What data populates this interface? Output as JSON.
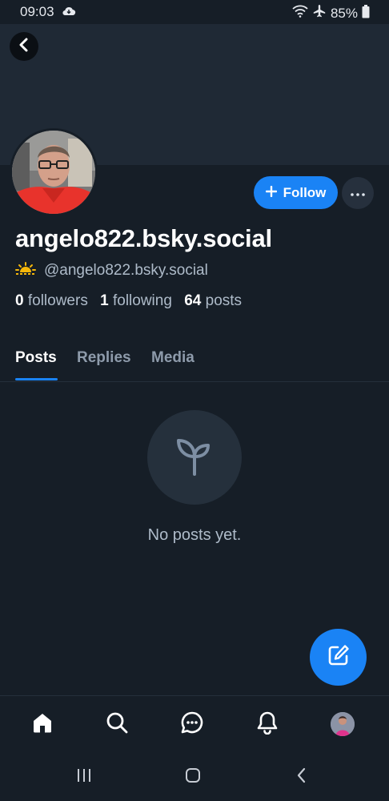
{
  "status_bar": {
    "time": "09:03",
    "battery": "85%",
    "icons": [
      "cloud-icon",
      "wifi-icon",
      "airplane-icon",
      "battery-icon"
    ]
  },
  "profile": {
    "display_name": "angelo822.bsky.social",
    "handle": "@angelo822.bsky.social",
    "followers_count": "0",
    "followers_label": "followers",
    "following_count": "1",
    "following_label": "following",
    "posts_count": "64",
    "posts_label": "posts"
  },
  "actions": {
    "follow_label": "Follow"
  },
  "tabs": [
    {
      "label": "Posts",
      "active": true
    },
    {
      "label": "Replies",
      "active": false
    },
    {
      "label": "Media",
      "active": false
    }
  ],
  "empty_state": {
    "message": "No posts yet.",
    "icon": "sprout-icon"
  },
  "bottom_nav": [
    "home-icon",
    "search-icon",
    "chat-icon",
    "bell-icon",
    "profile-avatar"
  ],
  "colors": {
    "background": "#161e27",
    "banner": "#1f2935",
    "accent": "#1a83f5",
    "muted_text": "#aebbc9"
  }
}
